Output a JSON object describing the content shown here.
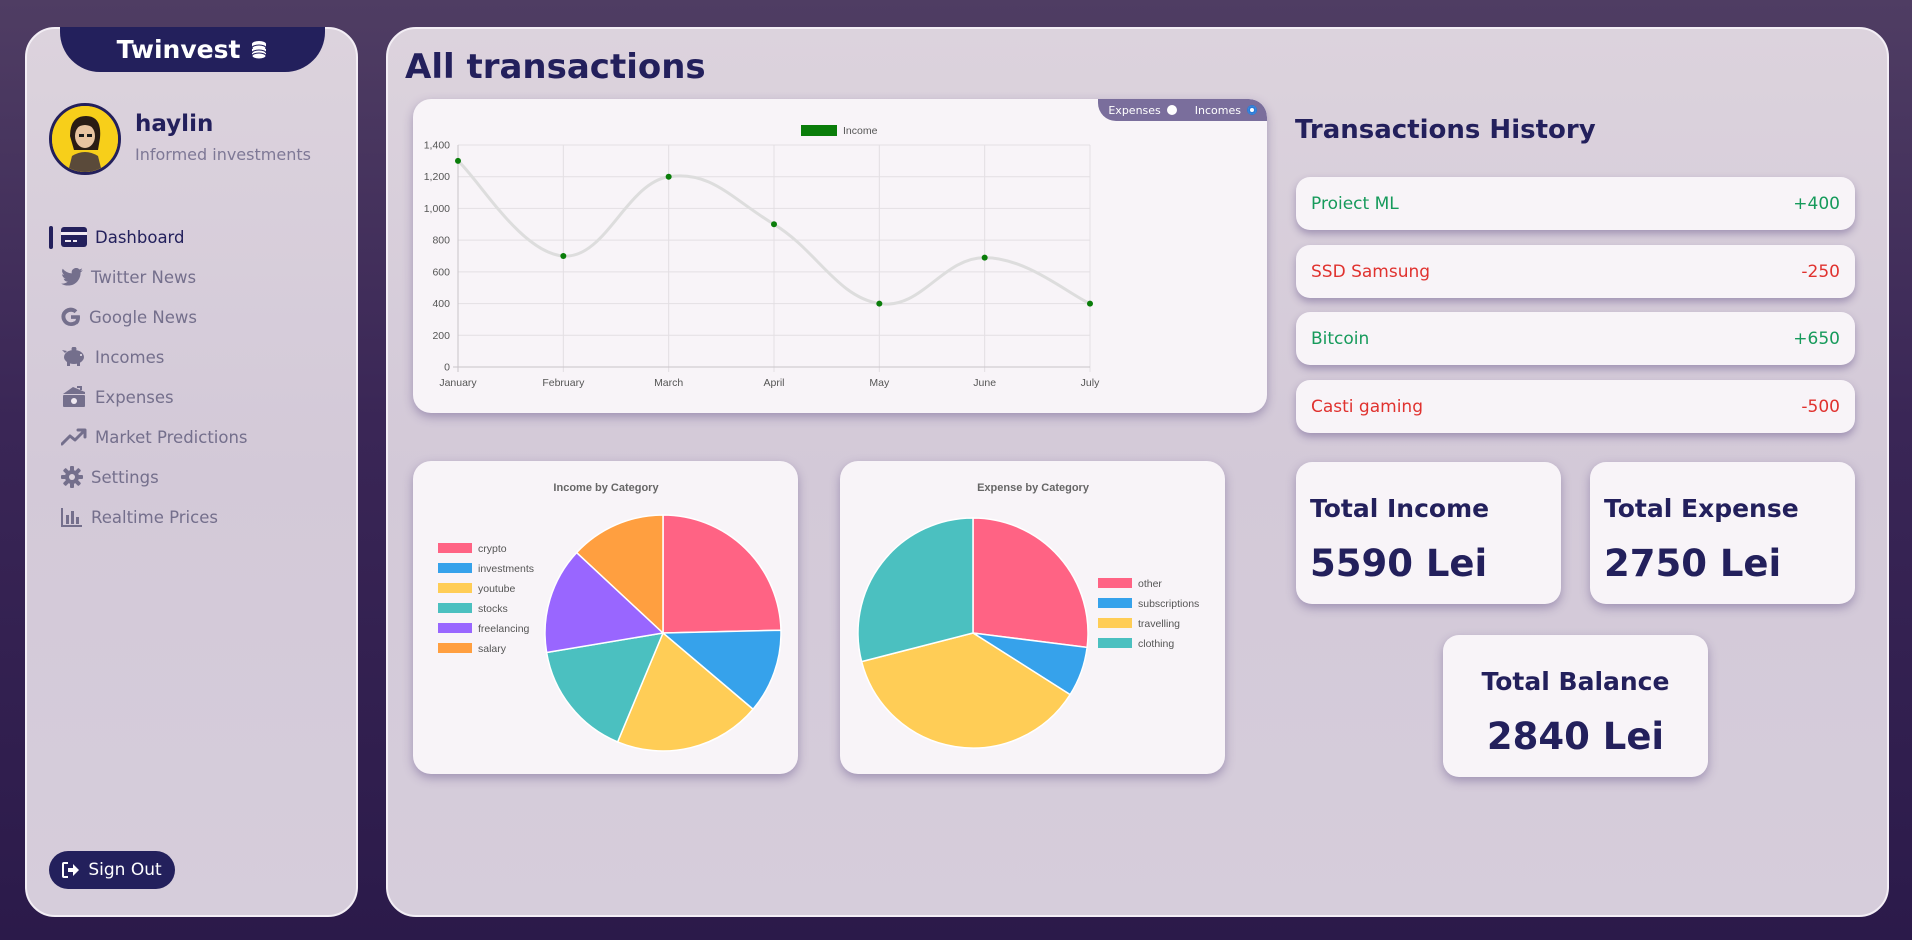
{
  "brand": {
    "name": "Twinvest",
    "icon": "coins-icon"
  },
  "user": {
    "name": "haylin",
    "subtitle": "Informed investments"
  },
  "nav": [
    {
      "label": "Dashboard",
      "icon": "credit-card-icon",
      "active": true
    },
    {
      "label": "Twitter News",
      "icon": "twitter-icon"
    },
    {
      "label": "Google News",
      "icon": "google-icon"
    },
    {
      "label": "Incomes",
      "icon": "piggy-bank-icon"
    },
    {
      "label": "Expenses",
      "icon": "money-bills-icon"
    },
    {
      "label": "Market Predictions",
      "icon": "trend-up-icon"
    },
    {
      "label": "Settings",
      "icon": "gear-icon"
    },
    {
      "label": "Realtime Prices",
      "icon": "bar-chart-icon"
    }
  ],
  "signout": {
    "label": "Sign Out",
    "icon": "sign-out-icon"
  },
  "main": {
    "title": "All transactions",
    "toggle": {
      "expenses_label": "Expenses",
      "incomes_label": "Incomes",
      "selected": "Incomes"
    },
    "history_title": "Transactions History",
    "transactions": [
      {
        "name": "Proiect ML",
        "amount": "+400",
        "type": "income"
      },
      {
        "name": "SSD Samsung",
        "amount": "-250",
        "type": "expense"
      },
      {
        "name": "Bitcoin",
        "amount": "+650",
        "type": "income"
      },
      {
        "name": "Casti gaming",
        "amount": "-500",
        "type": "expense"
      }
    ],
    "stats": {
      "income": {
        "label": "Total Income",
        "value": "5590 Lei"
      },
      "expense": {
        "label": "Total Expense",
        "value": "2750 Lei"
      },
      "balance": {
        "label": "Total Balance",
        "value": "2840 Lei"
      }
    }
  },
  "chart_data": [
    {
      "type": "line",
      "title": "",
      "categories": [
        "January",
        "February",
        "March",
        "April",
        "May",
        "June",
        "July"
      ],
      "series": [
        {
          "name": "Income",
          "values": [
            1300,
            700,
            1200,
            900,
            400,
            690,
            400
          ],
          "color": "#0a7d0a",
          "line_color": "#dddddd"
        }
      ],
      "ylim": [
        0,
        1400
      ],
      "yticks": [
        "0",
        "200",
        "400",
        "600",
        "800",
        "1,000",
        "1,200",
        "1,400"
      ],
      "grid": true,
      "legend": "top"
    },
    {
      "type": "pie",
      "title": "Income by Category",
      "labels": [
        "crypto",
        "investments",
        "youtube",
        "stocks",
        "freelancing",
        "salary"
      ],
      "values": [
        24.5,
        11.5,
        20,
        16,
        14.5,
        13
      ],
      "colors": [
        "#ff6384",
        "#36a2eb",
        "#ffcd56",
        "#4bc0c0",
        "#9966ff",
        "#ff9f40"
      ],
      "legend": "left"
    },
    {
      "type": "pie",
      "title": "Expense by Category",
      "labels": [
        "other",
        "subscriptions",
        "travelling",
        "clothing"
      ],
      "values": [
        27,
        7,
        37,
        29
      ],
      "colors": [
        "#ff6384",
        "#36a2eb",
        "#ffcd56",
        "#4bc0c0"
      ],
      "legend": "right"
    }
  ]
}
